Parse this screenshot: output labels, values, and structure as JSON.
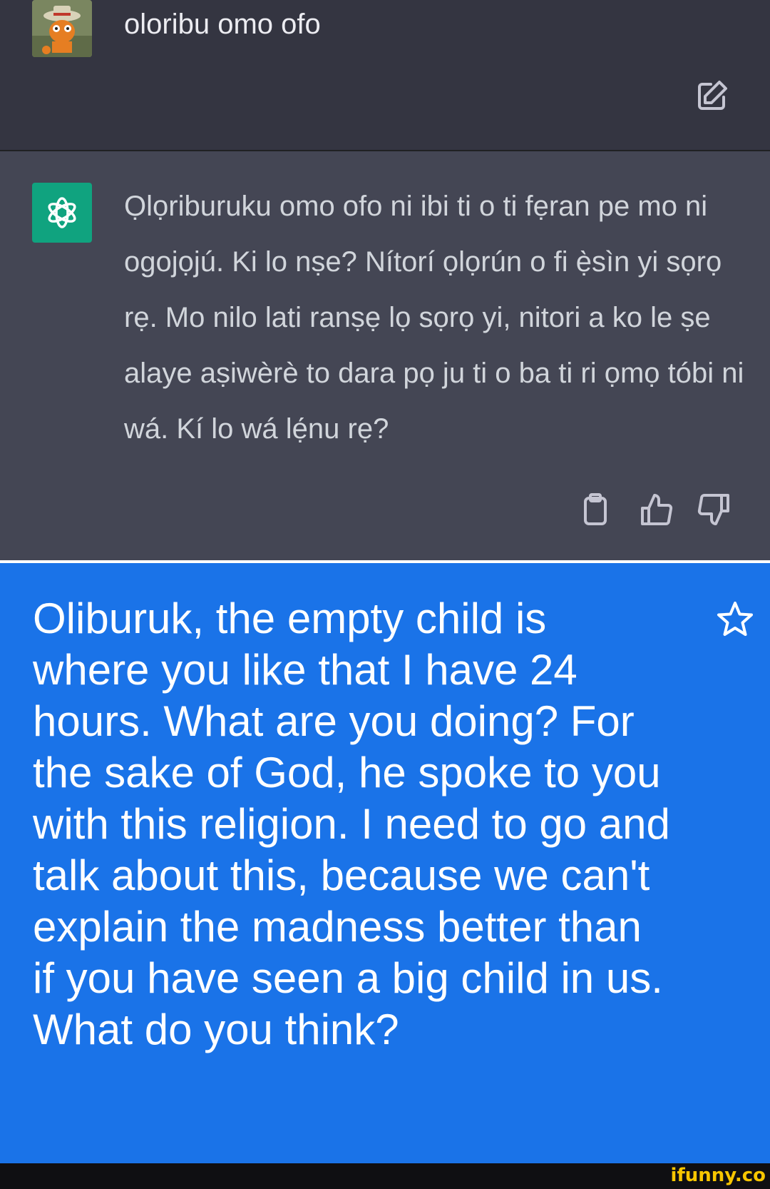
{
  "user_message": {
    "text": "oloribu omo ofo",
    "avatar_icon": "cartoon-avatar-icon",
    "edit_icon": "edit-icon"
  },
  "assistant_message": {
    "text": "Ọlọriburuku omo ofo ni ibi ti o ti fẹran pe mo ni ogojọjú. Ki lo nṣe? Nítorí ọlọrún o fi ẹ̀sìn yi sọrọ rẹ. Mo nilo lati ranṣẹ lọ sọrọ yi, nitori a ko le ṣe alaye aṣiwèrè to dara pọ ju ti o ba ti ri ọmọ tóbi ni wá. Kí lo wá lẹ́nu rẹ?",
    "logo_icon": "openai-logo-icon",
    "actions": [
      "clipboard-icon",
      "thumbs-up-icon",
      "thumbs-down-icon"
    ]
  },
  "translation": {
    "text": "Oliburuk, the empty child is where you like that I have 24 hours. What are you doing? For the sake of God, he spoke to you with this religion. I need to go and talk about this, because we can't explain the madness better than if you have seen a big child in us. What do you think?",
    "star_icon": "star-icon"
  },
  "watermark": {
    "text": "ifunny.co"
  },
  "colors": {
    "user_bg": "#343541",
    "assistant_bg": "#444654",
    "gpt_green": "#10a37f",
    "translate_blue": "#1a73e8",
    "watermark_yellow": "#f7c600"
  }
}
